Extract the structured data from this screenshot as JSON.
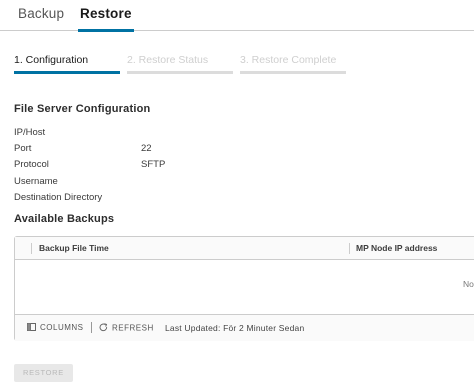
{
  "tabs": {
    "backup": "Backup",
    "restore": "Restore"
  },
  "steps": {
    "s1": "1. Configuration",
    "s2": "2. Restore Status",
    "s3": "3. Restore Complete"
  },
  "file_server": {
    "title": "File Server Configuration",
    "fields": [
      {
        "label": "IP/Host",
        "value": ""
      },
      {
        "label": "Port",
        "value": "22"
      },
      {
        "label": "Protocol",
        "value": "SFTP"
      },
      {
        "label": "Username",
        "value": ""
      },
      {
        "label": "Destination Directory",
        "value": ""
      }
    ]
  },
  "backups": {
    "title": "Available Backups",
    "columns": [
      "Backup File Time",
      "MP Node IP address"
    ],
    "empty_text": "No",
    "footer": {
      "columns_label": "COLUMNS",
      "refresh_label": "REFRESH",
      "last_updated": "Last Updated: För 2 Minuter Sedan"
    }
  },
  "actions": {
    "restore_label": "RESTORE"
  },
  "colors": {
    "accent": "#0072a3",
    "disabled_bar": "#dcdcdc"
  },
  "icons": {
    "columns": "columns-icon",
    "refresh": "refresh-icon"
  }
}
